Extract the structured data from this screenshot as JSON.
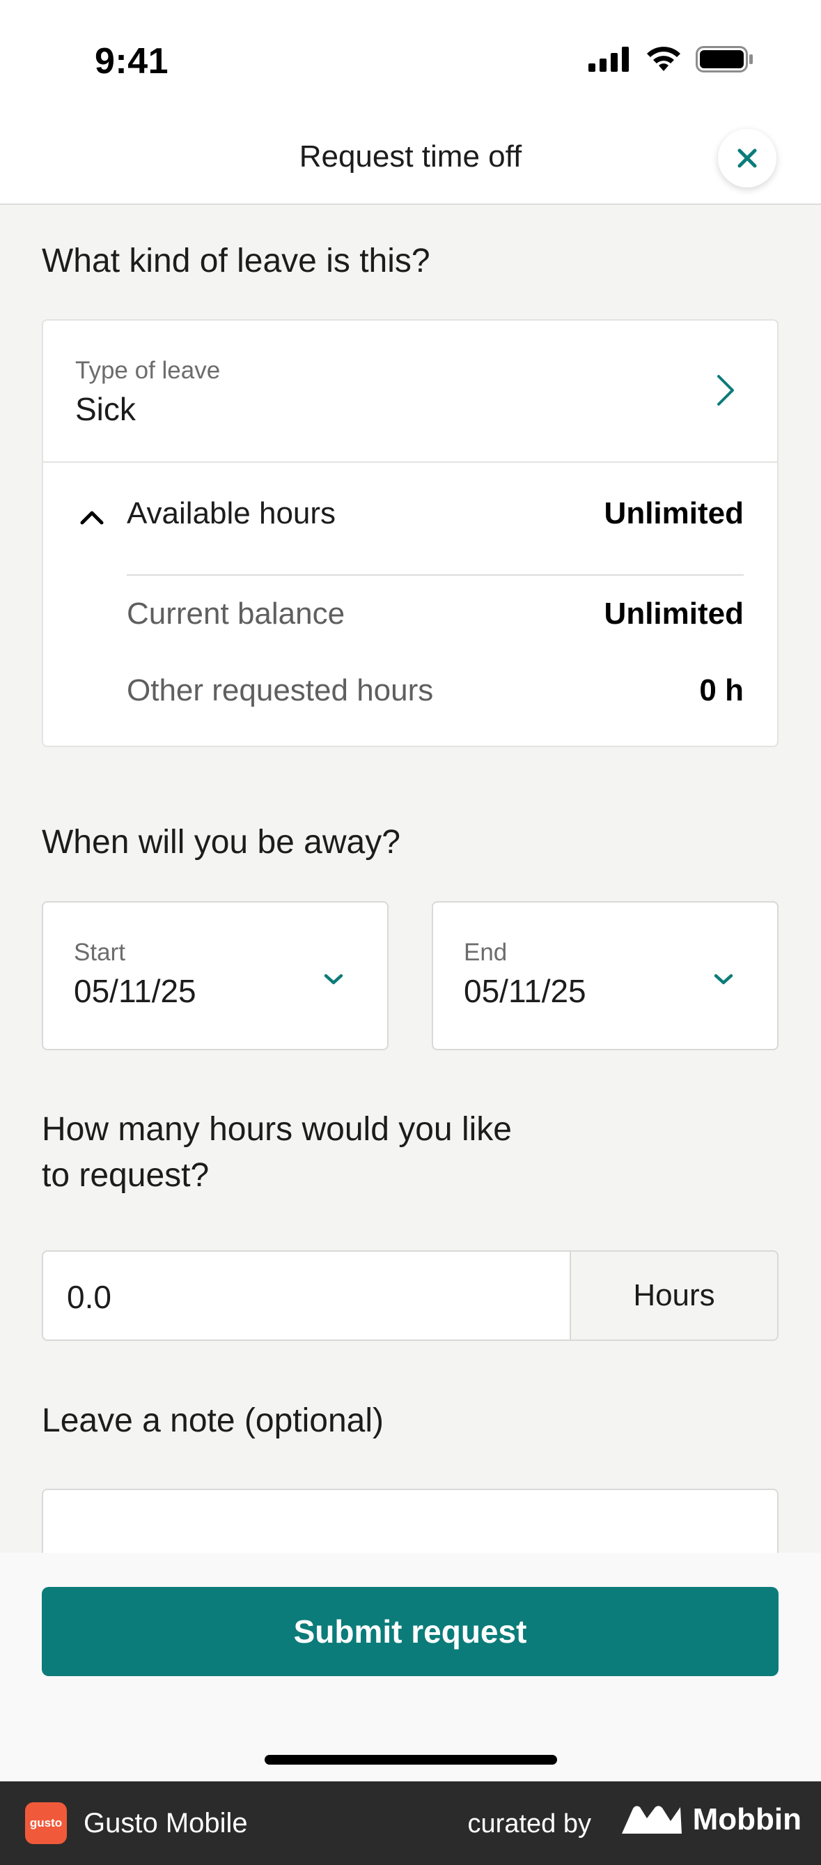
{
  "status_bar": {
    "time": "9:41"
  },
  "nav": {
    "title": "Request time off"
  },
  "leave_section": {
    "heading": "What kind of leave is this?",
    "type_label": "Type of leave",
    "type_value": "Sick",
    "available": {
      "label": "Available hours",
      "value": "Unlimited"
    },
    "current_balance": {
      "label": "Current balance",
      "value": "Unlimited"
    },
    "other_requested": {
      "label": "Other requested hours",
      "value": "0 h"
    }
  },
  "dates_section": {
    "heading": "When will you be away?",
    "start": {
      "label": "Start",
      "value": "05/11/25"
    },
    "end": {
      "label": "End",
      "value": "05/11/25"
    }
  },
  "hours_section": {
    "heading_line1": "How many hours would you like",
    "heading_line2": "to request?",
    "value": "0.0",
    "unit": "Hours"
  },
  "note_section": {
    "heading": "Leave a note (optional)"
  },
  "submit": {
    "label": "Submit request"
  },
  "footer": {
    "app_logo_text": "gusto",
    "app_name": "Gusto Mobile",
    "curated_by": "curated by",
    "brand": "Mobbin"
  },
  "colors": {
    "accent": "#0b7c7a",
    "logo": "#f05a3a"
  }
}
